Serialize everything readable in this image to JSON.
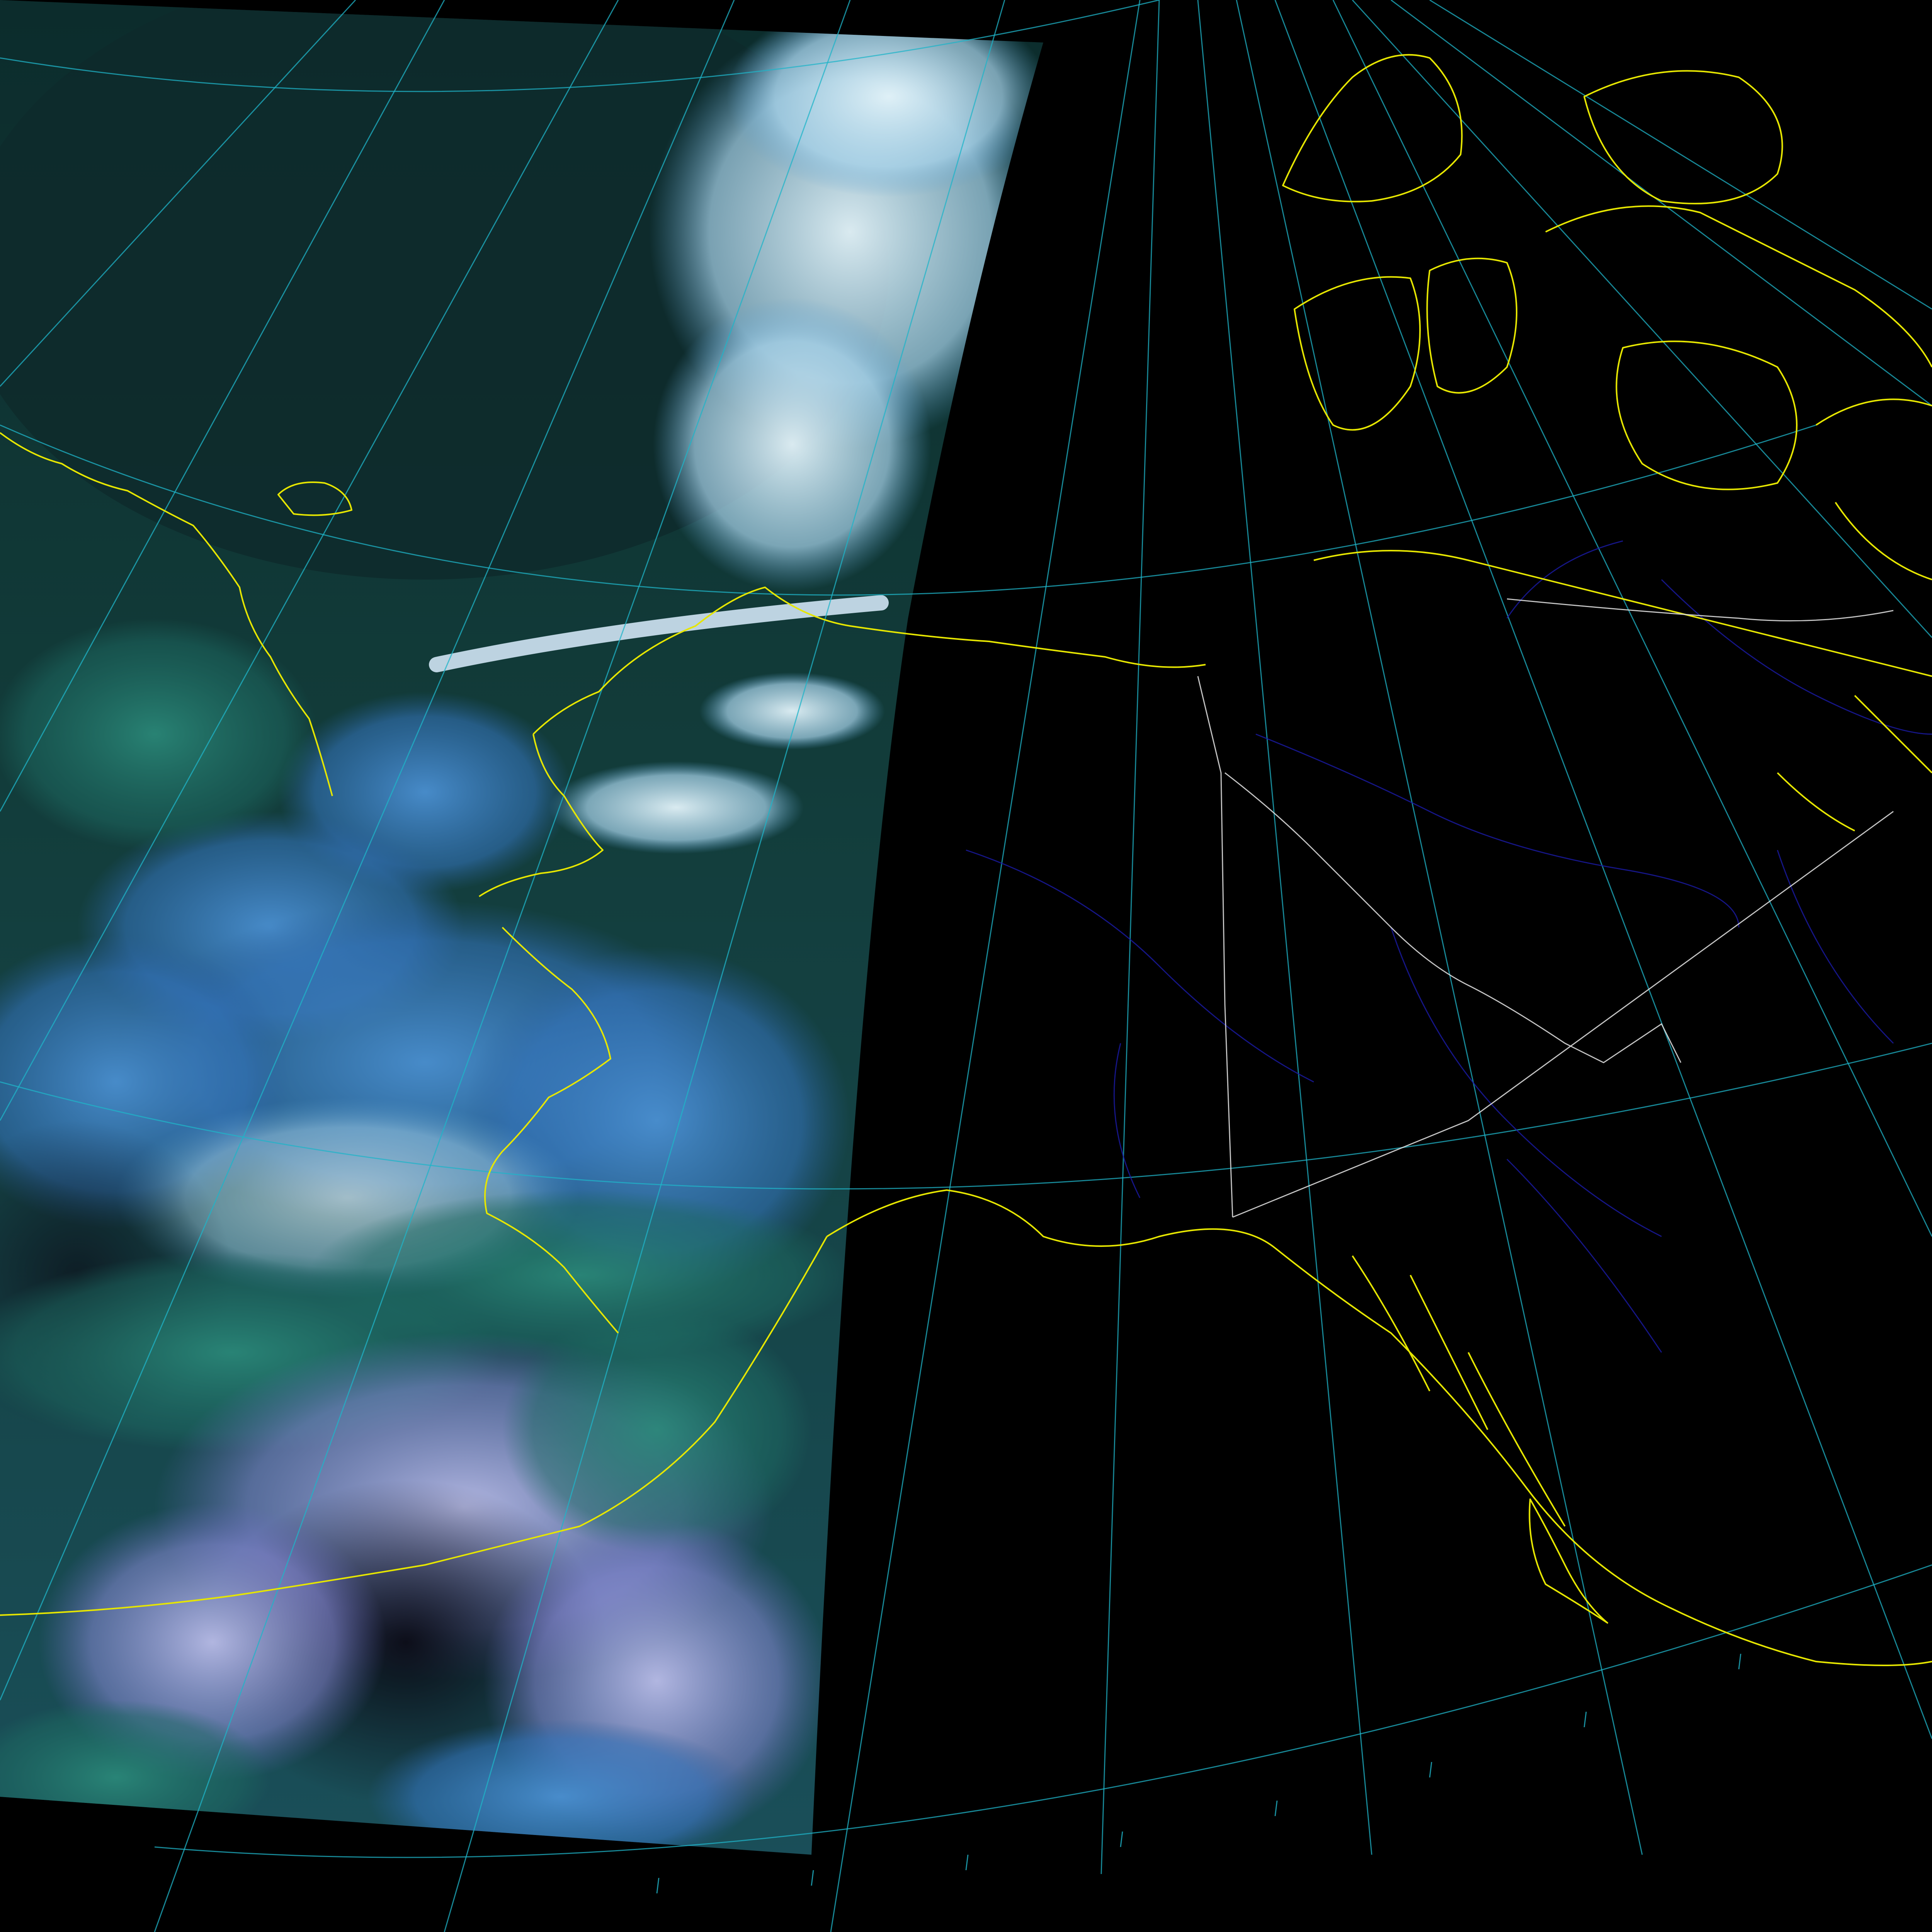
{
  "map": {
    "projection": "polar-conic",
    "colors": {
      "background": "#000000",
      "graticule": "#1fb4c8",
      "coastline": "#e6e600",
      "rivers": "#1a1aa8",
      "borders": "#d8d8d8",
      "ocean_dark": "#0c2a2c",
      "ocean_teal": "#1b5a57",
      "cloud_blue": "#3d7fc0",
      "cloud_white": "#c8e6f2",
      "night_side": "#000000"
    },
    "layers": [
      "satellite-swath",
      "graticule",
      "rivers",
      "coastlines",
      "political-borders"
    ]
  }
}
